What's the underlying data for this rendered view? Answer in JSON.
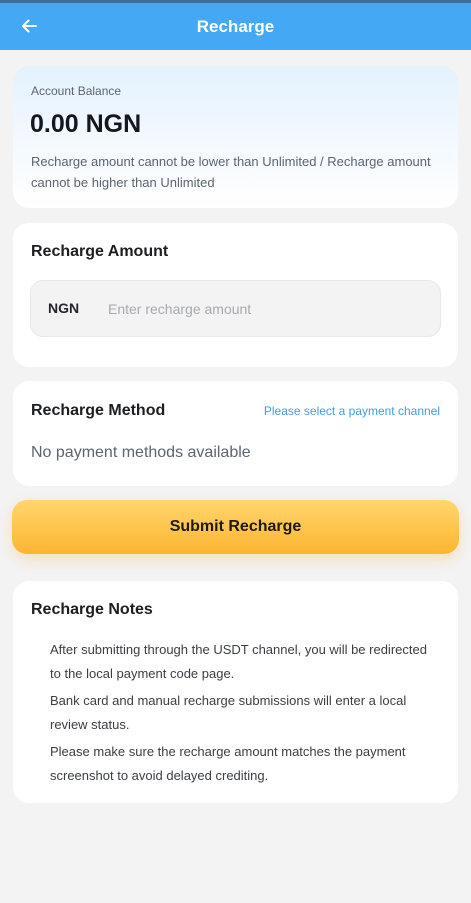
{
  "header": {
    "title": "Recharge",
    "back_icon": "arrow-left-icon",
    "color": "#45a8f5"
  },
  "balance": {
    "label": "Account Balance",
    "value": "0.00 NGN",
    "note": "Recharge amount cannot be lower than Unlimited / Recharge amount cannot be higher than Unlimited"
  },
  "amount": {
    "heading": "Recharge Amount",
    "currency": "NGN",
    "value": "",
    "placeholder": "Enter recharge amount"
  },
  "method": {
    "heading": "Recharge Method",
    "select_link": "Please select a payment channel",
    "empty_text": "No payment methods available",
    "link_color": "#3f9ee6"
  },
  "submit": {
    "label": "Submit Recharge",
    "color": "#fec44b"
  },
  "notes": {
    "heading": "Recharge Notes",
    "items": [
      "After submitting through the USDT channel, you will be redirected to the local payment code page.",
      "Bank card and manual recharge submissions will enter a local review status.",
      "Please make sure the recharge amount matches the payment screenshot to avoid delayed crediting."
    ]
  }
}
